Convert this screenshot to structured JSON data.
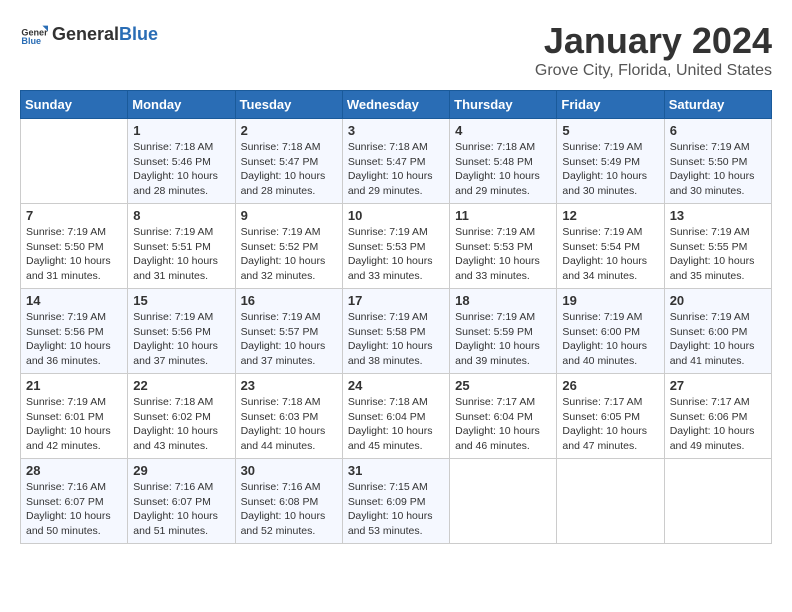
{
  "logo": {
    "text_general": "General",
    "text_blue": "Blue"
  },
  "title": "January 2024",
  "location": "Grove City, Florida, United States",
  "weekdays": [
    "Sunday",
    "Monday",
    "Tuesday",
    "Wednesday",
    "Thursday",
    "Friday",
    "Saturday"
  ],
  "weeks": [
    [
      {
        "day": "",
        "sunrise": "",
        "sunset": "",
        "daylight": ""
      },
      {
        "day": "1",
        "sunrise": "7:18 AM",
        "sunset": "5:46 PM",
        "daylight": "10 hours and 28 minutes."
      },
      {
        "day": "2",
        "sunrise": "7:18 AM",
        "sunset": "5:47 PM",
        "daylight": "10 hours and 28 minutes."
      },
      {
        "day": "3",
        "sunrise": "7:18 AM",
        "sunset": "5:47 PM",
        "daylight": "10 hours and 29 minutes."
      },
      {
        "day": "4",
        "sunrise": "7:18 AM",
        "sunset": "5:48 PM",
        "daylight": "10 hours and 29 minutes."
      },
      {
        "day": "5",
        "sunrise": "7:19 AM",
        "sunset": "5:49 PM",
        "daylight": "10 hours and 30 minutes."
      },
      {
        "day": "6",
        "sunrise": "7:19 AM",
        "sunset": "5:50 PM",
        "daylight": "10 hours and 30 minutes."
      }
    ],
    [
      {
        "day": "7",
        "sunrise": "7:19 AM",
        "sunset": "5:50 PM",
        "daylight": "10 hours and 31 minutes."
      },
      {
        "day": "8",
        "sunrise": "7:19 AM",
        "sunset": "5:51 PM",
        "daylight": "10 hours and 31 minutes."
      },
      {
        "day": "9",
        "sunrise": "7:19 AM",
        "sunset": "5:52 PM",
        "daylight": "10 hours and 32 minutes."
      },
      {
        "day": "10",
        "sunrise": "7:19 AM",
        "sunset": "5:53 PM",
        "daylight": "10 hours and 33 minutes."
      },
      {
        "day": "11",
        "sunrise": "7:19 AM",
        "sunset": "5:53 PM",
        "daylight": "10 hours and 33 minutes."
      },
      {
        "day": "12",
        "sunrise": "7:19 AM",
        "sunset": "5:54 PM",
        "daylight": "10 hours and 34 minutes."
      },
      {
        "day": "13",
        "sunrise": "7:19 AM",
        "sunset": "5:55 PM",
        "daylight": "10 hours and 35 minutes."
      }
    ],
    [
      {
        "day": "14",
        "sunrise": "7:19 AM",
        "sunset": "5:56 PM",
        "daylight": "10 hours and 36 minutes."
      },
      {
        "day": "15",
        "sunrise": "7:19 AM",
        "sunset": "5:56 PM",
        "daylight": "10 hours and 37 minutes."
      },
      {
        "day": "16",
        "sunrise": "7:19 AM",
        "sunset": "5:57 PM",
        "daylight": "10 hours and 37 minutes."
      },
      {
        "day": "17",
        "sunrise": "7:19 AM",
        "sunset": "5:58 PM",
        "daylight": "10 hours and 38 minutes."
      },
      {
        "day": "18",
        "sunrise": "7:19 AM",
        "sunset": "5:59 PM",
        "daylight": "10 hours and 39 minutes."
      },
      {
        "day": "19",
        "sunrise": "7:19 AM",
        "sunset": "6:00 PM",
        "daylight": "10 hours and 40 minutes."
      },
      {
        "day": "20",
        "sunrise": "7:19 AM",
        "sunset": "6:00 PM",
        "daylight": "10 hours and 41 minutes."
      }
    ],
    [
      {
        "day": "21",
        "sunrise": "7:19 AM",
        "sunset": "6:01 PM",
        "daylight": "10 hours and 42 minutes."
      },
      {
        "day": "22",
        "sunrise": "7:18 AM",
        "sunset": "6:02 PM",
        "daylight": "10 hours and 43 minutes."
      },
      {
        "day": "23",
        "sunrise": "7:18 AM",
        "sunset": "6:03 PM",
        "daylight": "10 hours and 44 minutes."
      },
      {
        "day": "24",
        "sunrise": "7:18 AM",
        "sunset": "6:04 PM",
        "daylight": "10 hours and 45 minutes."
      },
      {
        "day": "25",
        "sunrise": "7:17 AM",
        "sunset": "6:04 PM",
        "daylight": "10 hours and 46 minutes."
      },
      {
        "day": "26",
        "sunrise": "7:17 AM",
        "sunset": "6:05 PM",
        "daylight": "10 hours and 47 minutes."
      },
      {
        "day": "27",
        "sunrise": "7:17 AM",
        "sunset": "6:06 PM",
        "daylight": "10 hours and 49 minutes."
      }
    ],
    [
      {
        "day": "28",
        "sunrise": "7:16 AM",
        "sunset": "6:07 PM",
        "daylight": "10 hours and 50 minutes."
      },
      {
        "day": "29",
        "sunrise": "7:16 AM",
        "sunset": "6:07 PM",
        "daylight": "10 hours and 51 minutes."
      },
      {
        "day": "30",
        "sunrise": "7:16 AM",
        "sunset": "6:08 PM",
        "daylight": "10 hours and 52 minutes."
      },
      {
        "day": "31",
        "sunrise": "7:15 AM",
        "sunset": "6:09 PM",
        "daylight": "10 hours and 53 minutes."
      },
      {
        "day": "",
        "sunrise": "",
        "sunset": "",
        "daylight": ""
      },
      {
        "day": "",
        "sunrise": "",
        "sunset": "",
        "daylight": ""
      },
      {
        "day": "",
        "sunrise": "",
        "sunset": "",
        "daylight": ""
      }
    ]
  ],
  "labels": {
    "sunrise": "Sunrise:",
    "sunset": "Sunset:",
    "daylight": "Daylight:"
  }
}
